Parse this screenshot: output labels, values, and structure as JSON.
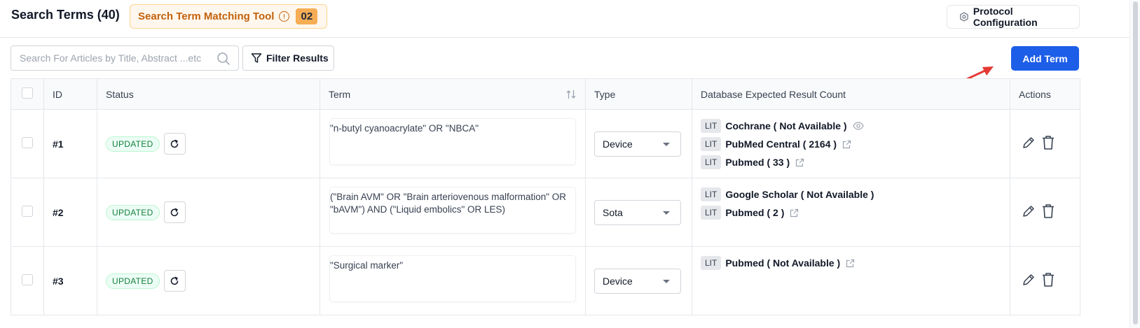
{
  "header": {
    "title": "Search Terms (40)",
    "tool_label": "Search Term Matching Tool",
    "tool_count": "02",
    "protocol_label": "Protocol Configuration"
  },
  "toolbar": {
    "search_placeholder": "Search For Articles by Title, Abstract ...etc",
    "filter_label": "Filter Results",
    "add_label": "Add Term"
  },
  "table": {
    "columns": {
      "id": "ID",
      "status": "Status",
      "term": "Term",
      "type": "Type",
      "db": "Database Expected Result Count",
      "actions": "Actions"
    },
    "rows": [
      {
        "id": "#1",
        "status": "UPDATED",
        "term": "\"n-butyl cyanoacrylate\" OR \"NBCA\"",
        "type": "Device",
        "databases": [
          {
            "tag": "LIT",
            "label": "Cochrane ( Not Available )",
            "icon": "eye-icon"
          },
          {
            "tag": "LIT",
            "label": "PubMed Central ( 2164 )",
            "icon": "external-link-icon"
          },
          {
            "tag": "LIT",
            "label": "Pubmed ( 33 )",
            "icon": "external-link-icon"
          }
        ]
      },
      {
        "id": "#2",
        "status": "UPDATED",
        "term": "(\"Brain AVM\" OR \"Brain arteriovenous malformation\" OR \"bAVM\") AND (\"Liquid embolics\" OR LES)",
        "type": "Sota",
        "databases": [
          {
            "tag": "LIT",
            "label": "Google Scholar ( Not Available )",
            "icon": ""
          },
          {
            "tag": "LIT",
            "label": "Pubmed ( 2 )",
            "icon": "external-link-icon"
          }
        ]
      },
      {
        "id": "#3",
        "status": "UPDATED",
        "term": "\"Surgical marker\"",
        "type": "Device",
        "databases": [
          {
            "tag": "LIT",
            "label": "Pubmed ( Not Available )",
            "icon": "external-link-icon"
          }
        ]
      }
    ]
  },
  "colors": {
    "primary": "#1d5ee8",
    "tool_text": "#c2610c",
    "tool_bg": "#fff7ed",
    "badge_text": "#15803d",
    "annotation": "#e53935"
  }
}
